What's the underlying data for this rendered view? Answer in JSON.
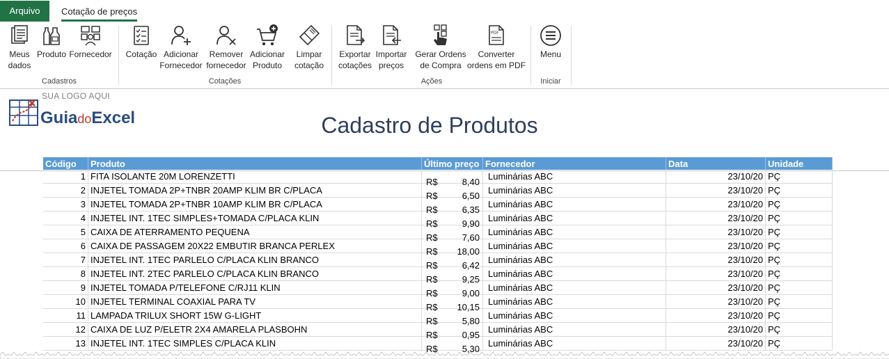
{
  "tabs": {
    "file": "Arquivo",
    "active": "Cotação de preços"
  },
  "ribbon": {
    "groups": [
      {
        "label": "Cadastros",
        "buttons": [
          {
            "label": "Meus\ndados",
            "icon": "documents-icon"
          },
          {
            "label": "Produto",
            "icon": "bottles-icon"
          },
          {
            "label": "Fornecedor",
            "icon": "supplier-icon"
          }
        ]
      },
      {
        "label": "Cotações",
        "buttons": [
          {
            "label": "Cotação",
            "icon": "checklist-icon"
          },
          {
            "label": "Adicionar\nFornecedor",
            "icon": "add-user-icon"
          },
          {
            "label": "Remover\nfornecedor",
            "icon": "remove-user-icon"
          },
          {
            "label": "Adicionar\nProduto",
            "icon": "add-cart-icon"
          },
          {
            "label": "Limpar\ncotação",
            "icon": "eraser-icon"
          }
        ]
      },
      {
        "label": "Ações",
        "buttons": [
          {
            "label": "Exportar\ncotações",
            "icon": "export-doc-icon"
          },
          {
            "label": "Importar\npreços",
            "icon": "import-doc-icon"
          },
          {
            "label": "Gerar Ordens\nde Compra",
            "icon": "touch-icon"
          },
          {
            "label": "Converter\nordens em PDF",
            "icon": "pdf-icon"
          }
        ]
      },
      {
        "label": "Iniciar",
        "buttons": [
          {
            "label": "Menu",
            "icon": "hamburger-icon"
          }
        ]
      }
    ]
  },
  "logo": {
    "tagline": "SUA LOGO AQUI",
    "brand_a": "Guia",
    "brand_b": "do",
    "brand_c": "Excel"
  },
  "page_title": "Cadastro de Produtos",
  "table": {
    "headers": [
      "Código",
      "Produto",
      "Último preço",
      "Fornecedor",
      "Data",
      "Unidade"
    ],
    "currency": "R$",
    "rows": [
      [
        "1",
        "FITA ISOLANTE 20M LORENZETTI",
        "8,40",
        "Luminárias ABC",
        "23/10/20",
        "PÇ"
      ],
      [
        "2",
        "INJETEL TOMADA 2P+TNBR 20AMP KLIM BR C/PLACA",
        "6,50",
        "Luminárias ABC",
        "23/10/20",
        "PÇ"
      ],
      [
        "3",
        "INJETEL TOMADA 2P+TNBR 10AMP KLIM BR C/PLACA",
        "6,35",
        "Luminárias ABC",
        "23/10/20",
        "PÇ"
      ],
      [
        "4",
        "INJETEL INT. 1TEC SIMPLES+TOMADA C/PLACA KLIN",
        "9,90",
        "Luminárias ABC",
        "23/10/20",
        "PÇ"
      ],
      [
        "5",
        "CAIXA DE ATERRAMENTO PEQUENA",
        "7,60",
        "Luminárias ABC",
        "23/10/20",
        "PÇ"
      ],
      [
        "6",
        "CAIXA DE PASSAGEM 20X22 EMBUTIR BRANCA PERLEX",
        "18,00",
        "Luminárias ABC",
        "23/10/20",
        "PÇ"
      ],
      [
        "7",
        "INJETEL INT. 1TEC PARLELO C/PLACA KLIN BRANCO",
        "6,42",
        "Luminárias ABC",
        "23/10/20",
        "PÇ"
      ],
      [
        "8",
        "INJETEL INT. 2TEC PARLELO C/PLACA KLIN BRANCO",
        "9,25",
        "Luminárias ABC",
        "23/10/20",
        "PÇ"
      ],
      [
        "9",
        "INJETEL TOMADA P/TELEFONE C/RJ11 KLIN",
        "9,00",
        "Luminárias ABC",
        "23/10/20",
        "PÇ"
      ],
      [
        "10",
        "INJETEL TERMINAL COAXIAL PARA TV",
        "10,15",
        "Luminárias ABC",
        "23/10/20",
        "PÇ"
      ],
      [
        "11",
        "LAMPADA TRILUX SHORT 15W G-LIGHT",
        "5,80",
        "Luminárias ABC",
        "23/10/20",
        "PÇ"
      ],
      [
        "12",
        "CAIXA DE LUZ P/ELETR 2X4 AMARELA PLASBOHN",
        "0,95",
        "Luminárias ABC",
        "23/10/20",
        "PÇ"
      ],
      [
        "13",
        "INJETEL INT. 1TEC SIMPLES C/PLACA KLIN",
        "5,30",
        "Luminárias ABC",
        "23/10/20",
        "PÇ"
      ]
    ]
  },
  "colors": {
    "accent": "#217346",
    "header_fill": "#5b9bd5",
    "title": "#2f3e5c",
    "logo": "#2b4c7e"
  }
}
